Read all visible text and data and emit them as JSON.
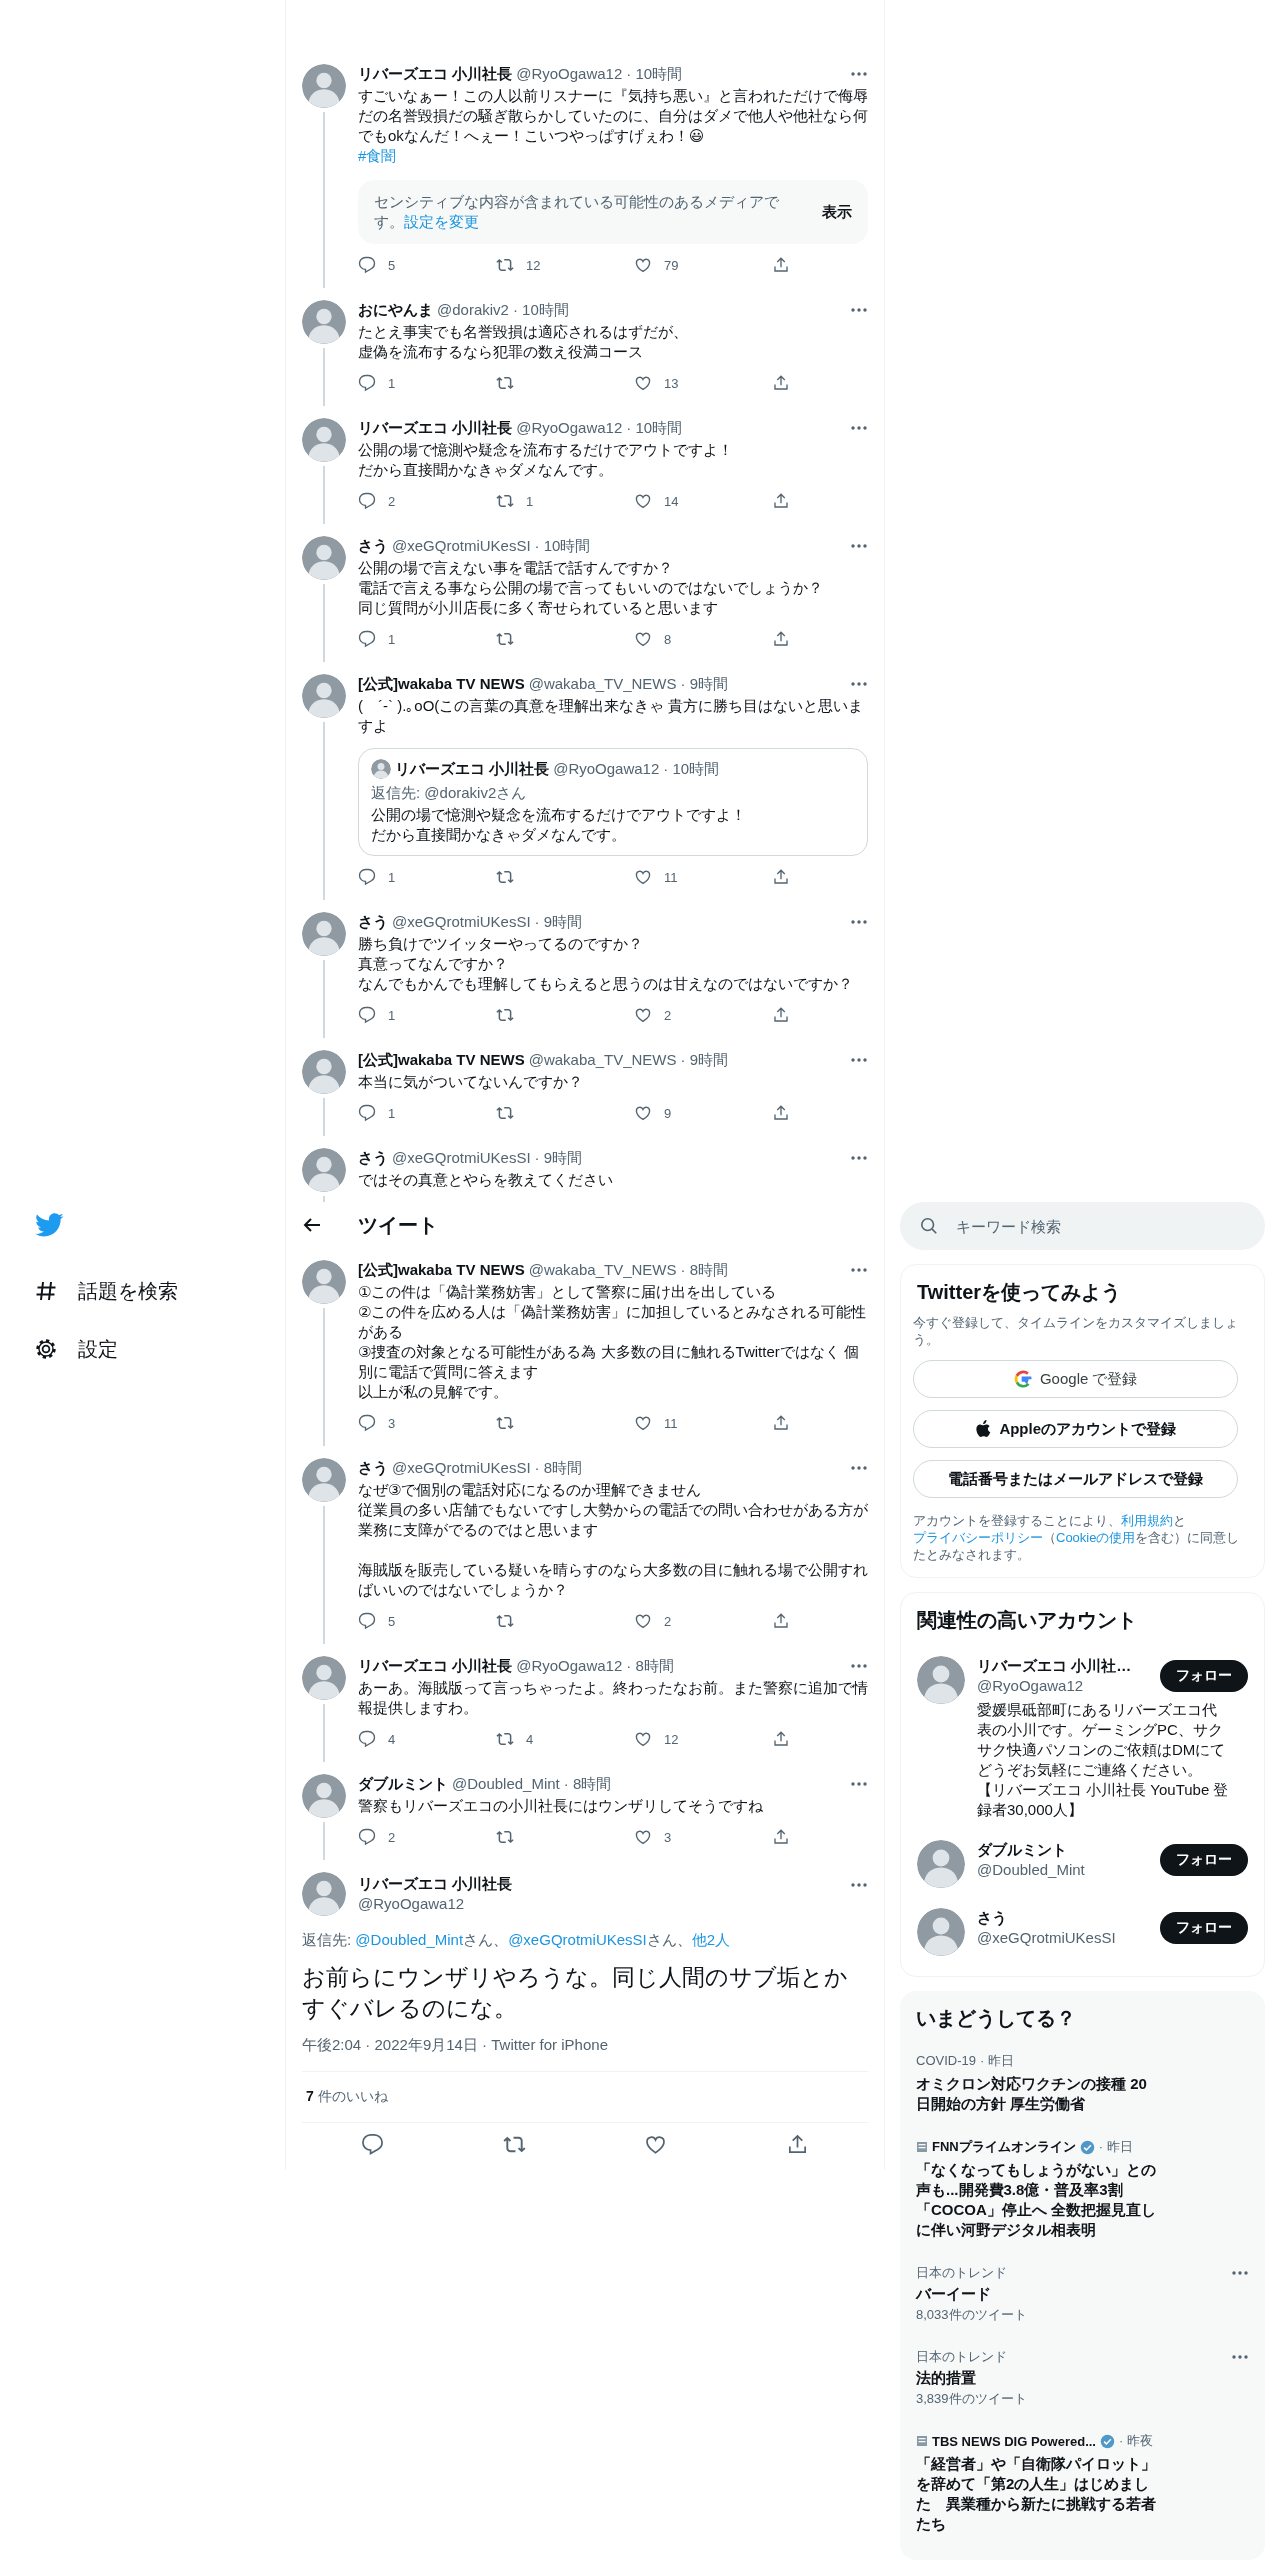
{
  "nav": {
    "items": [
      {
        "kind": "explore",
        "label": "話題を検索"
      },
      {
        "kind": "settings",
        "label": "設定"
      }
    ]
  },
  "timeline": [
    {
      "kind": "tweet",
      "name": "リバーズエコ 小川社長",
      "handle": "@RyoOgawa12",
      "time": "· 10時間",
      "text": [
        [
          "すごいなぁー！この人以前リスナーに『気持ち悪い』と言われただけで侮辱だの名誉毀損だの騒ぎ散らかしていたのに、自分はダメで他人や他社なら何でもokなんだ！へぇー！こいつやっぱすげぇわ！😃"
        ]
      ],
      "hashtag": "#食闇",
      "sensitive": {
        "text": "センシティブな内容が含まれている可能性のあるメディアです。",
        "link": "設定を変更",
        "button": "表示"
      },
      "replies": "5",
      "retweets": "12",
      "likes": "79"
    },
    {
      "kind": "tweet",
      "name": "おにやんま",
      "handle": "@dorakiv2",
      "time": "· 10時間",
      "text": [
        [
          "たとえ事実でも名誉毀損は適応されるはずだが、",
          "虚偽を流布するなら犯罪の数え役満コース"
        ]
      ],
      "replies": "1",
      "likes": "13"
    },
    {
      "kind": "tweet",
      "name": "リバーズエコ 小川社長",
      "handle": "@RyoOgawa12",
      "time": "· 10時間",
      "text": [
        [
          "公開の場で憶測や疑念を流布するだけでアウトですよ！",
          "だから直接聞かなきゃダメなんです。"
        ]
      ],
      "replies": "2",
      "retweets": "1",
      "likes": "14"
    },
    {
      "kind": "tweet",
      "name": "さう",
      "handle": "@xeGQrotmiUKesSI",
      "time": "· 10時間",
      "text": [
        [
          "公開の場で言えない事を電話で話すんですか？",
          "電話で言える事なら公開の場で言ってもいいのではないでしょうか？",
          "同じ質問が小川店長に多く寄せられていると思います"
        ]
      ],
      "replies": "1",
      "likes": "8"
    },
    {
      "kind": "tweet",
      "name": "[公式]wakaba TV NEWS",
      "handle": "@wakaba_TV_NEWS",
      "time": "· 9時間",
      "text": [
        [
          "(　´-` ).｡oO(この言葉の真意を理解出来なきゃ 貴方に勝ち目はないと思いますよ"
        ]
      ],
      "quote": {
        "name": "リバーズエコ 小川社長",
        "handle": "@RyoOgawa12",
        "time": "· 10時間",
        "reply_to": "返信先: @dorakiv2さん",
        "text": [
          [
            "公開の場で憶測や疑念を流布するだけでアウトですよ！",
            "だから直接聞かなきゃダメなんです。"
          ]
        ]
      },
      "replies": "1",
      "likes": "11"
    },
    {
      "kind": "tweet",
      "name": "さう",
      "handle": "@xeGQrotmiUKesSI",
      "time": "· 9時間",
      "text": [
        [
          "勝ち負けでツイッターやってるのですか？",
          "真意ってなんですか？",
          "なんでもかんでも理解してもらえると思うのは甘えなのではないですか？"
        ]
      ],
      "replies": "1",
      "likes": "2"
    },
    {
      "kind": "tweet",
      "name": "[公式]wakaba TV NEWS",
      "handle": "@wakaba_TV_NEWS",
      "time": "· 9時間",
      "text": [
        [
          "本当に気がついてないんですか？"
        ]
      ],
      "replies": "1",
      "likes": "9"
    },
    {
      "kind": "tweet_cut",
      "name": "さう",
      "handle": "@xeGQrotmiUKesSI",
      "time": "· 9時間",
      "text": [
        [
          "ではその真意とやらを教えてください"
        ]
      ]
    },
    {
      "kind": "header",
      "title": "ツイート"
    },
    {
      "kind": "tweet",
      "name": "[公式]wakaba TV NEWS",
      "handle": "@wakaba_TV_NEWS",
      "time": "· 8時間",
      "text": [
        [
          "①この件は「偽計業務妨害」として警察に届け出を出している",
          "②この件を広める人は「偽計業務妨害」に加担しているとみなされる可能性がある",
          "③捜査の対象となる可能性がある為 大多数の目に触れるTwitterではなく 個別に電話で質問に答えます",
          "以上が私の見解です。"
        ]
      ],
      "replies": "3",
      "likes": "11"
    },
    {
      "kind": "tweet",
      "name": "さう",
      "handle": "@xeGQrotmiUKesSI",
      "time": "· 8時間",
      "text": [
        [
          "なぜ③で個別の電話対応になるのか理解できません",
          "従業員の多い店舗でもないですし大勢からの電話での問い合わせがある方が業務に支障がでるのではと思います"
        ],
        [
          "海賊版を販売している疑いを晴らすのなら大多数の目に触れる場で公開すればいいのではないでしょうか？"
        ]
      ],
      "replies": "5",
      "likes": "2"
    },
    {
      "kind": "tweet",
      "name": "リバーズエコ 小川社長",
      "handle": "@RyoOgawa12",
      "time": "· 8時間",
      "text": [
        [
          "あーあ。海賊版って言っちゃったよ。終わったなお前。また警察に追加で情報提供しますわ。"
        ]
      ],
      "replies": "4",
      "retweets": "4",
      "likes": "12"
    },
    {
      "kind": "tweet",
      "name": "ダブルミント",
      "handle": "@Doubled_Mint",
      "time": "· 8時間",
      "text": [
        [
          "警察もリバーズエコの小川社長にはウンザリしてそうですね"
        ]
      ],
      "replies": "2",
      "likes": "3"
    }
  ],
  "main_tweet": {
    "name": "リバーズエコ 小川社長",
    "handle": "@RyoOgawa12",
    "reply_to": [
      {
        "kind": "text",
        "text": "返信先: "
      },
      {
        "kind": "link",
        "text": "@Doubled_Mint"
      },
      {
        "kind": "text",
        "text": "さん、"
      },
      {
        "kind": "link",
        "text": "@xeGQrotmiUKesSI"
      },
      {
        "kind": "text",
        "text": "さん、"
      },
      {
        "kind": "link",
        "text": "他2人"
      }
    ],
    "text": "お前らにウンザリやろうな。同じ人間のサブ垢とかすぐバレるのにな。",
    "meta": "午後2:04 · 2022年9月14日 · Twitter for iPhone",
    "likes": "**7** 件のいいね"
  },
  "search": {
    "placeholder": "キーワード検索"
  },
  "signup": {
    "title": "Twitterを使ってみよう",
    "subtitle": "今すぐ登録して、タイムラインをカスタマイズしましょう。",
    "buttons": [
      {
        "kind": "google",
        "label": "Google で登録"
      },
      {
        "kind": "apple",
        "label": "Appleのアカウントで登録"
      },
      {
        "kind": "plain",
        "label": "電話番号またはメールアドレスで登録"
      }
    ],
    "legal": [
      {
        "kind": "text",
        "text": "アカウントを登録することにより、"
      },
      {
        "kind": "link",
        "text": "利用規約"
      },
      {
        "kind": "text",
        "text": "と"
      },
      {
        "kind": "link",
        "text": "プライバシーポリシー"
      },
      {
        "kind": "text",
        "text": "（"
      },
      {
        "kind": "link",
        "text": "Cookieの使用"
      },
      {
        "kind": "text",
        "text": "を含む）に同意したとみなされます。"
      }
    ]
  },
  "related": {
    "title": "関連性の高いアカウント",
    "accounts": [
      {
        "name": "リバーズエコ 小川社…",
        "handle": "@RyoOgawa12",
        "bio": "愛媛県砥部町にあるリバーズエコ代表の小川です。ゲーミングPC、サクサク快適パソコンのご依頼はDMにてどうぞお気軽にご連絡ください。【リバーズエコ 小川社長 YouTube 登録者30,000人】",
        "button": "フォロー"
      },
      {
        "name": "ダブルミント",
        "handle": "@Doubled_Mint",
        "button": "フォロー"
      },
      {
        "name": "さう",
        "handle": "@xeGQrotmiUKesSI",
        "button": "フォロー"
      }
    ]
  },
  "trends": {
    "title": "いまどうしてる？",
    "items": [
      {
        "kind": "topic",
        "source": "COVID-19",
        "time": "· 昨日",
        "headline": "オミクロン対応ワクチンの接種 20日開始の方針 厚生労働省"
      },
      {
        "kind": "account",
        "source": "FNNプライムオンライン",
        "verified": true,
        "time": "· 昨日",
        "headline": "「なくなってもしょうがない」との声も...開発費3.8億・普及率3割「COCOA」停止へ 全数把握見直しに伴い河野デジタル相表明"
      },
      {
        "kind": "trend",
        "category": "日本のトレンド",
        "title": "バーイード",
        "count": "8,033件のツイート"
      },
      {
        "kind": "trend",
        "category": "日本のトレンド",
        "title": "法的措置",
        "count": "3,839件のツイート"
      },
      {
        "kind": "account",
        "source": "TBS NEWS DIG Powered...",
        "verified": true,
        "time": "· 昨夜",
        "headline": "「経営者」や「自衛隊パイロット」を辞めて「第2の人生」はじめました　異業種から新たに挑戦する若者たち"
      }
    ]
  }
}
